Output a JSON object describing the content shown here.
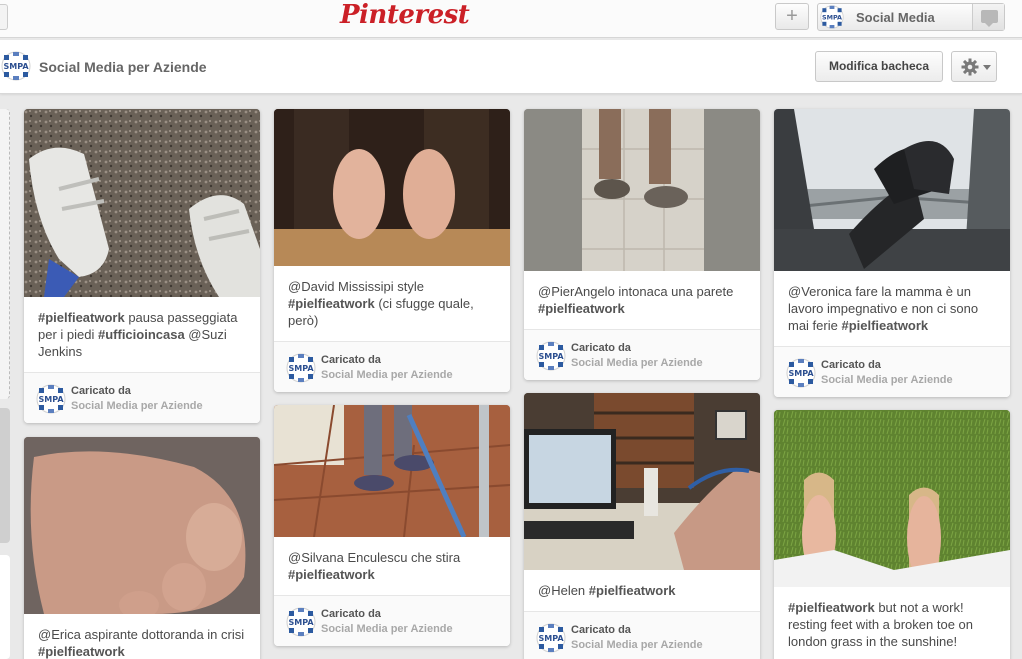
{
  "header": {
    "logo": "Pinterest",
    "add_label": "+",
    "user_name": "Social Media"
  },
  "board": {
    "title": "Social Media per Aziende",
    "edit_label": "Modifica bacheca"
  },
  "credit": {
    "label": "Caricato da",
    "name": "Social Media per Aziende"
  },
  "pins": [
    {
      "id": "p1",
      "desc_tag": "#pielfieatwork",
      "desc_text": " pausa passeggiata per i piedi ",
      "desc_tag2": "#ufficioincasa",
      "desc_text2": " @Suzi Jenkins"
    },
    {
      "id": "p2",
      "desc_text": "@Erica aspirante dottoranda in crisi ",
      "desc_tag": "#pielfieatwork"
    },
    {
      "id": "p3",
      "desc_text": "@David Mississipi style ",
      "desc_tag": "#pielfieatwork",
      "desc_text2": " (ci sfugge quale, però)"
    },
    {
      "id": "p4",
      "desc_text": "@Silvana Enculescu che stira ",
      "desc_tag": "#pielfieatwork"
    },
    {
      "id": "p5",
      "desc_text": "@PierAngelo intonaca una parete ",
      "desc_tag": "#pielfieatwork"
    },
    {
      "id": "p6",
      "desc_text": "@Helen ",
      "desc_tag": "#pielfieatwork"
    },
    {
      "id": "p7",
      "desc_text": "@Veronica fare la mamma è un lavoro impegnativo e non ci sono mai ferie ",
      "desc_tag": "#pielfieatwork"
    },
    {
      "id": "p8",
      "desc_tag": "#pielfieatwork",
      "desc_text": " but not a work! resting feet with a broken toe on london grass in the sunshine!"
    }
  ],
  "colors": {
    "brand": "#cb2027",
    "background": "#e9e9e9"
  },
  "icons": [
    "plus-icon",
    "notification-icon",
    "gear-icon",
    "chevron-down-icon",
    "smpa-avatar"
  ]
}
